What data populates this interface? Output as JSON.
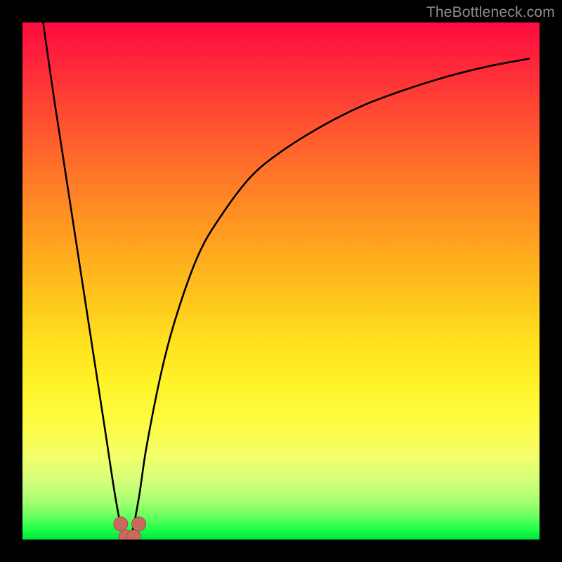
{
  "watermark": "TheBottleneck.com",
  "chart_data": {
    "type": "line",
    "title": "",
    "xlabel": "",
    "ylabel": "",
    "xlim": [
      0,
      100
    ],
    "ylim": [
      0,
      100
    ],
    "grid": false,
    "series": [
      {
        "name": "bottleneck-curve",
        "x": [
          4,
          6,
          8,
          10,
          12,
          14,
          16,
          18,
          19.5,
          21,
          22.5,
          24,
          27,
          30,
          34,
          38,
          44,
          50,
          58,
          66,
          74,
          82,
          90,
          98
        ],
        "y": [
          100,
          86,
          73,
          60,
          47,
          34,
          21,
          8,
          1,
          1,
          8,
          18,
          33,
          44,
          55,
          62,
          70,
          75,
          80,
          84,
          87,
          89.5,
          91.5,
          93
        ]
      }
    ],
    "annotations": [
      {
        "name": "marker-left-shoulder",
        "x": 19,
        "y": 3
      },
      {
        "name": "marker-valley-left",
        "x": 20,
        "y": 0.5
      },
      {
        "name": "marker-valley-right",
        "x": 21.5,
        "y": 0.5
      },
      {
        "name": "marker-right-shoulder",
        "x": 22.5,
        "y": 3
      }
    ],
    "colors": {
      "curve": "#000000",
      "marker_fill": "#c86a60",
      "marker_stroke": "#a04f46",
      "gradient_top": "#ff0b40",
      "gradient_bottom": "#00e63a",
      "background": "#000000"
    }
  }
}
